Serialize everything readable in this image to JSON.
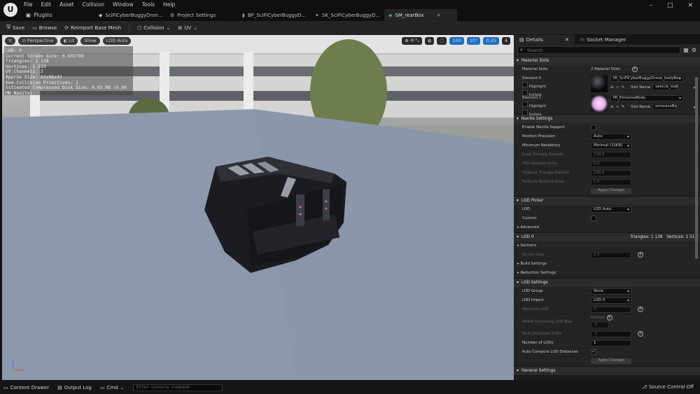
{
  "menu": {
    "logo": "U",
    "items": [
      "File",
      "Edit",
      "Asset",
      "Collision",
      "Window",
      "Tools",
      "Help"
    ],
    "plugins_label": "Plugins"
  },
  "tabs": [
    {
      "label": "SciFiCyberBuggyDron...",
      "icon": "mesh-icon"
    },
    {
      "label": "Project Settings",
      "icon": "gear-icon"
    },
    {
      "label": "BP_SciFiCyberBuggyD...",
      "icon": "blueprint-icon"
    },
    {
      "label": "SK_SciFiCyberBuggyD...",
      "icon": "skeleton-icon"
    },
    {
      "label": "SM_rearBox",
      "icon": "static-mesh-icon",
      "active": true
    }
  ],
  "window_controls": [
    "–",
    "□",
    "✕"
  ],
  "toolbar": {
    "save": "Save",
    "browse": "Browse",
    "reimport": "Reimport Base Mesh",
    "collision": "Collision",
    "uv": "UV"
  },
  "viewport": {
    "menu_label": "≡",
    "perspective": "Perspective",
    "lit": "Lit",
    "show": "Show",
    "lod_auto": "LOD Auto",
    "right_controls": [
      "100",
      "10°",
      "0.25",
      "4"
    ],
    "stats": [
      "LOD:  0",
      "Current Screen Size:  0.502799",
      "Triangles:  1 138",
      "Vertices:  1 513",
      "UV Channels:  2",
      "Approx Size: 63x96x42",
      "Num Collision Primitives:  1",
      "Estimated Compressed Disk Size: 0,03 MB (0,00 MB Nanite)"
    ],
    "axis": {
      "x": "X",
      "y": "Y",
      "z": "Z"
    }
  },
  "details": {
    "tab_details": "Details",
    "tab_socket": "Socket Manager",
    "search_placeholder": "Search",
    "material_slots": {
      "header": "Material Slots",
      "label": "Material Slots",
      "count": "2 Material Slots",
      "elements": [
        {
          "name": "Element 0",
          "highlight": "Highlight",
          "isolate": "Isolate",
          "material": "MI_SciFiCyberBuggyDrone_bodyBox",
          "slot_label": "Slot Name",
          "slot": "vehicle_bod"
        },
        {
          "name": "Element 1",
          "highlight": "Highlight",
          "isolate": "Isolate",
          "material": "MI_EmissiveBody",
          "slot_label": "Slot Name",
          "slot": "emissiveBo"
        }
      ]
    },
    "nanite": {
      "header": "Nanite Settings",
      "rows": [
        {
          "label": "Enable Nanite Support",
          "type": "check",
          "value": ""
        },
        {
          "label": "Position Precision",
          "type": "drop",
          "value": "Auto"
        },
        {
          "label": "Minimum Residency",
          "type": "drop",
          "value": "Minimal (32KB)"
        },
        {
          "label": "Keep Triangle Percent",
          "type": "num",
          "value": "100,0",
          "disabled": true
        },
        {
          "label": "Trim Relative Error",
          "type": "num",
          "value": "0,0",
          "disabled": true
        },
        {
          "label": "Fallback Triangle Percent",
          "type": "num",
          "value": "100,0",
          "disabled": true
        },
        {
          "label": "Fallback Relative Error",
          "type": "num",
          "value": "1,0",
          "disabled": true
        }
      ],
      "apply": "Apply Changes"
    },
    "lod_picker": {
      "header": "LOD Picker",
      "lod_label": "LOD",
      "lod_value": "LOD Auto",
      "custom_label": "Custom",
      "advanced": "Advanced"
    },
    "lod0": {
      "header": "LOD 0",
      "triangles": "Triangles: 1 138",
      "vertices": "Vertices: 1 513",
      "sections": "Sections",
      "screen_size_label": "Screen Size",
      "screen_size_value": "2,0",
      "build_settings": "Build Settings",
      "reduction_settings": "Reduction Settings"
    },
    "lod_settings": {
      "header": "LOD Settings",
      "lod_group_label": "LOD Group",
      "lod_group_value": "None",
      "lod_import_label": "LOD Import",
      "lod_import_value": "LOD 0",
      "min_lod_label": "Minimum LOD",
      "min_lod_value": "0",
      "nostream_label": "NoRef Streaming LOD Bias",
      "nostream_default": "Default",
      "nostream_value": "-1",
      "num_streamed_label": "Num Streamed LODs",
      "num_streamed_value": "-1",
      "num_lods_label": "Number of LODs",
      "num_lods_value": "1",
      "auto_compute_label": "Auto Compute LOD Distances",
      "apply": "Apply Changes"
    },
    "general_settings": "General Settings"
  },
  "status": {
    "content_drawer": "Content Drawer",
    "output_log": "Output Log",
    "cmd": "Cmd",
    "console_placeholder": "Enter Console Command",
    "source_control": "Source Control Off"
  }
}
